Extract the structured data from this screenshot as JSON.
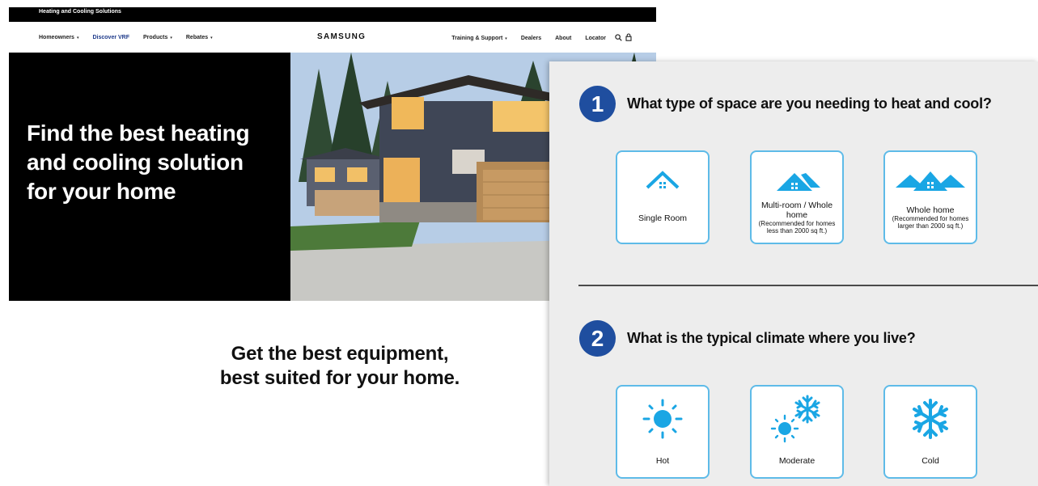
{
  "topbar": {
    "title": "Heating and Cooling Solutions"
  },
  "nav": {
    "left": [
      {
        "label": "Homeowners",
        "caret": "▾"
      },
      {
        "label": "Discover VRF",
        "caret": ""
      },
      {
        "label": "Products",
        "caret": "▾"
      },
      {
        "label": "Rebates",
        "caret": "▾"
      }
    ],
    "brand": "SAMSUNG",
    "right": [
      {
        "label": "Training & Support",
        "caret": "▾"
      },
      {
        "label": "Dealers",
        "caret": ""
      },
      {
        "label": "About",
        "caret": ""
      },
      {
        "label": "Locator",
        "caret": ""
      }
    ]
  },
  "hero": {
    "title": "Find the best heating and cooling solution for your home"
  },
  "tagline": {
    "line1": "Get the best equipment,",
    "line2": "best suited for your home."
  },
  "quiz": {
    "q1": {
      "number": "1",
      "text": "What type of space are you needing to heat and cool?",
      "options": [
        {
          "label": "Single Room",
          "sub": ""
        },
        {
          "label": "Multi-room / Whole home",
          "sub": "(Recommended for homes less than 2000 sq ft.)"
        },
        {
          "label": "Whole home",
          "sub": "(Recommended for homes larger than 2000 sq ft.)"
        }
      ]
    },
    "q2": {
      "number": "2",
      "text": "What is the typical climate where you live?",
      "options": [
        {
          "label": "Hot"
        },
        {
          "label": "Moderate"
        },
        {
          "label": "Cold"
        }
      ]
    }
  },
  "colors": {
    "accent": "#1f4e9f",
    "icon": "#1aa6e4",
    "card_border": "#5ebbe8",
    "nav_active": "#1d3a8a"
  }
}
